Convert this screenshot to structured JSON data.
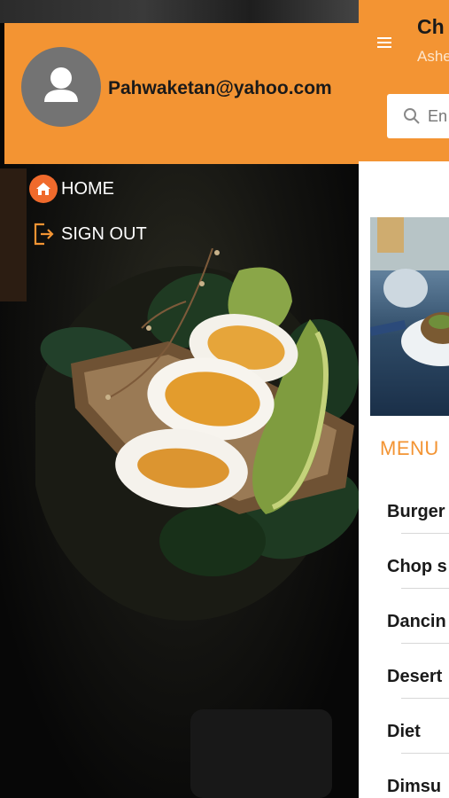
{
  "drawer": {
    "email": "Pahwaketan@yahoo.com",
    "nav": [
      {
        "label": "HOME",
        "icon": "home-icon"
      },
      {
        "label": "SIGN OUT",
        "icon": "sign-out-icon"
      }
    ]
  },
  "appbar": {
    "title": "Ch",
    "subtitle": "Ashe",
    "search_placeholder": "En"
  },
  "menu": {
    "heading": "MENU",
    "items": [
      "Burger",
      "Chop s",
      "Dancin",
      "Desert",
      "Diet",
      "Dimsu"
    ]
  },
  "colors": {
    "accent": "#f39433",
    "home_icon_bg": "#f06a2c",
    "avatar_bg": "#737373"
  }
}
